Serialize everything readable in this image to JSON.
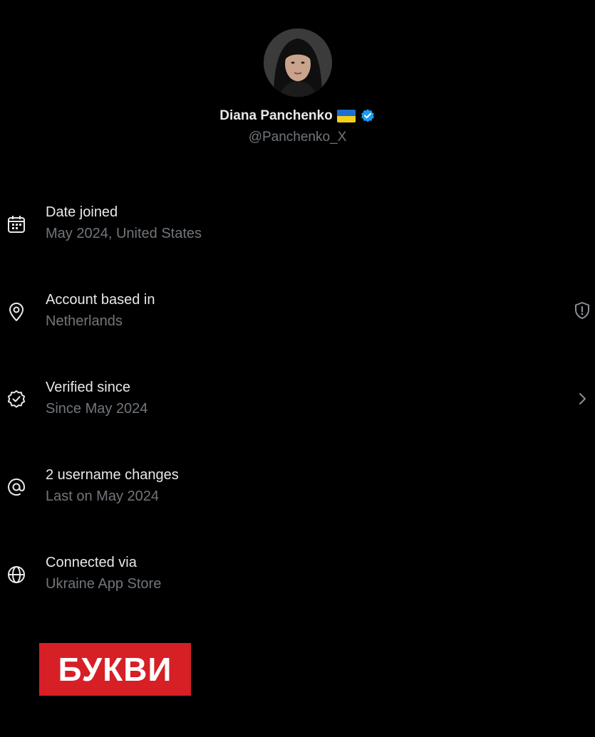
{
  "profile": {
    "display_name": "Diana Panchenko",
    "handle": "@Panchenko_X",
    "flag_icon": "ukraine-flag-icon",
    "verified_icon": "verified-badge-icon",
    "verified_color": "#1d9bf0"
  },
  "info": [
    {
      "icon": "calendar-icon",
      "title": "Date joined",
      "subtitle": "May 2024, United States"
    },
    {
      "icon": "location-pin-icon",
      "title": "Account based in",
      "subtitle": "Netherlands",
      "action_icon": "shield-alert-icon"
    },
    {
      "icon": "verified-outline-icon",
      "title": "Verified since",
      "subtitle": "Since May 2024",
      "action_icon": "chevron-right-icon"
    },
    {
      "icon": "at-sign-icon",
      "title": "2 username changes",
      "subtitle": "Last on May 2024"
    },
    {
      "icon": "globe-icon",
      "title": "Connected via",
      "subtitle": "Ukraine App Store"
    }
  ],
  "brand": {
    "label": "БУКВИ",
    "color": "#d71f26"
  },
  "colors": {
    "background": "#000000",
    "primary_text": "#e7e9ea",
    "secondary_text": "#71767b"
  }
}
